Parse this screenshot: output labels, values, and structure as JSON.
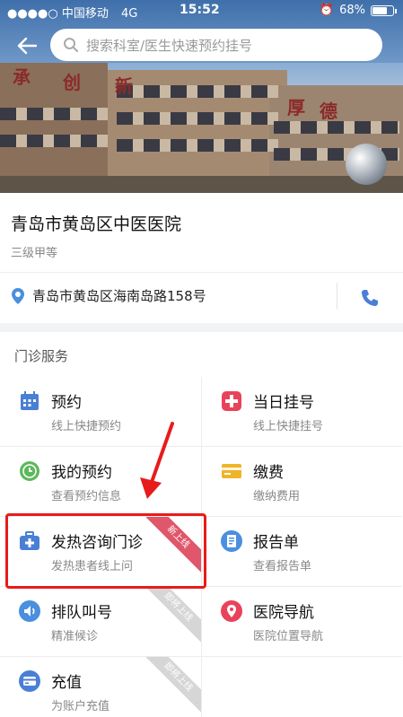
{
  "status_bar": {
    "carrier": "中国移动",
    "network": "4G",
    "time": "15:52",
    "battery": "68%"
  },
  "search": {
    "placeholder": "搜索科室/医生快速预约挂号"
  },
  "hero": {
    "signs": [
      "承",
      "创",
      "新",
      "厚",
      "德"
    ]
  },
  "hospital": {
    "name": "青岛市黄岛区中医医院",
    "level": "三级甲等",
    "address": "青岛市黄岛区海南岛路158号"
  },
  "services": {
    "title": "门诊服务",
    "items": [
      {
        "title": "预约",
        "subtitle": "线上快捷预约",
        "icon": "calendar-icon",
        "color": "#4a7fd6"
      },
      {
        "title": "当日挂号",
        "subtitle": "线上快捷挂号",
        "icon": "medical-cross-icon",
        "color": "#e8435a"
      },
      {
        "title": "我的预约",
        "subtitle": "查看预约信息",
        "icon": "clock-icon",
        "color": "#5cb85c"
      },
      {
        "title": "缴费",
        "subtitle": "缴纳费用",
        "icon": "card-icon",
        "color": "#f0b429"
      },
      {
        "title": "发热咨询门诊",
        "subtitle": "发热患者线上问",
        "icon": "medkit-icon",
        "color": "#4a7fd6",
        "badge": "新上线"
      },
      {
        "title": "报告单",
        "subtitle": "查看报告单",
        "icon": "document-icon",
        "color": "#4a8fe0"
      },
      {
        "title": "排队叫号",
        "subtitle": "精准候诊",
        "icon": "speaker-icon",
        "color": "#4a8fe0",
        "badge": "即将上线"
      },
      {
        "title": "医院导航",
        "subtitle": "医院位置导航",
        "icon": "location-icon",
        "color": "#e8435a"
      },
      {
        "title": "充值",
        "subtitle": "为账户充值",
        "icon": "wallet-icon",
        "color": "#4a7fd6",
        "badge": "即将上线"
      }
    ]
  },
  "colors": {
    "accent": "#4a7fd6",
    "highlight": "#e81b1b"
  }
}
